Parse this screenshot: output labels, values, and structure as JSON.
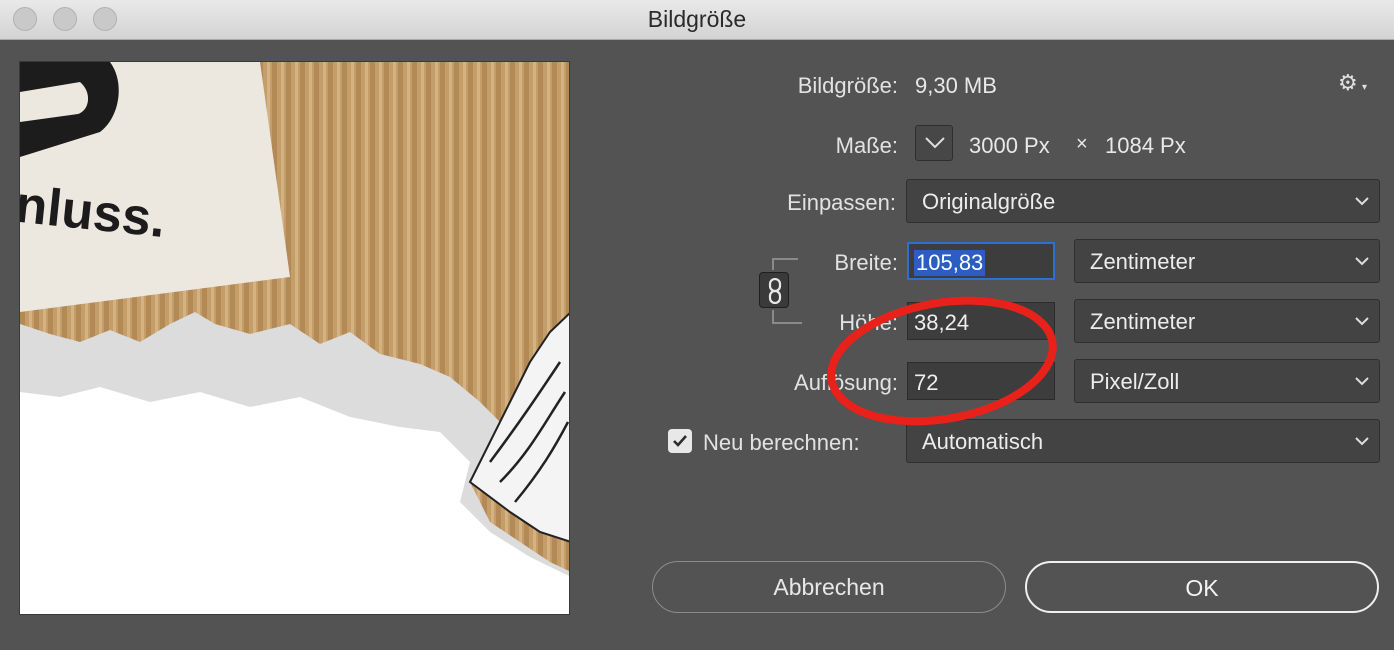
{
  "window": {
    "title": "Bildgröße"
  },
  "preview": {
    "visible_text": "nluss."
  },
  "summary": {
    "size_label": "Bildgröße:",
    "size_value": "9,30 MB",
    "dimensions_label": "Maße:",
    "width_px": "3000 Px",
    "times": "×",
    "height_px": "1084 Px"
  },
  "fit": {
    "label": "Einpassen:",
    "value": "Originalgröße"
  },
  "width": {
    "label": "Breite:",
    "value": "105,83",
    "unit": "Zentimeter"
  },
  "height": {
    "label": "Höhe:",
    "value": "38,24",
    "unit": "Zentimeter"
  },
  "resolution": {
    "label": "Auflösung:",
    "value": "72",
    "unit": "Pixel/Zoll"
  },
  "resample": {
    "label": "Neu berechnen:",
    "checked": true,
    "value": "Automatisch"
  },
  "buttons": {
    "cancel": "Abbrechen",
    "ok": "OK"
  },
  "icons": {
    "gear": "gear-icon",
    "dimensions_toggle": "chevron-down-icon",
    "link": "chain-link-icon",
    "checkbox": "checkmark-icon"
  },
  "colors": {
    "dialog_bg": "#535353",
    "highlight": "#2a5ec0",
    "annotation": "#e8221a"
  }
}
